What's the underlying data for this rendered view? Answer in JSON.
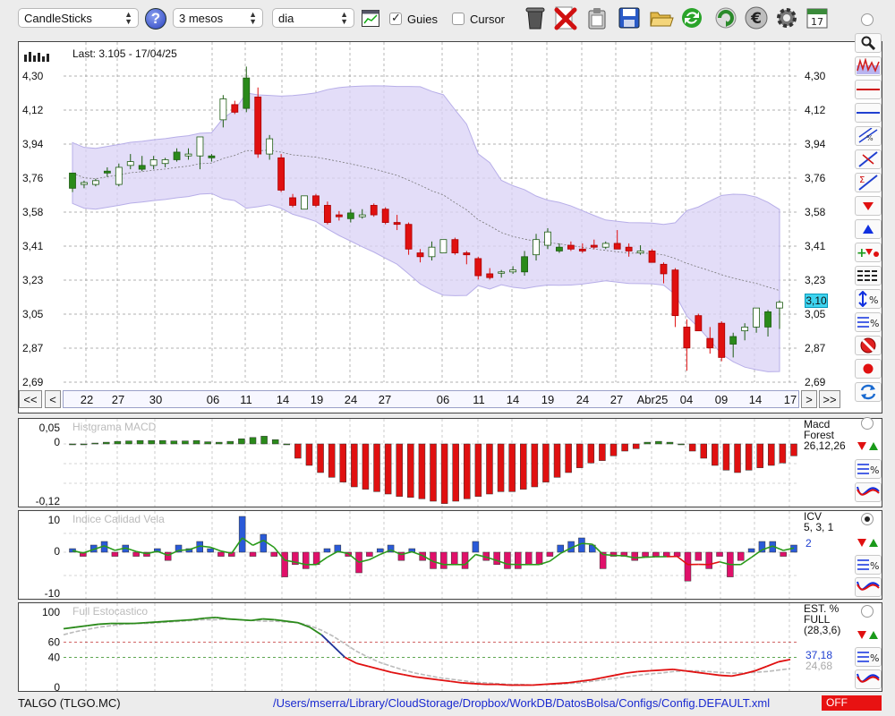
{
  "toolbar": {
    "chart_type": "CandleSticks",
    "period": "3 mesos",
    "interval": "dia",
    "guides_label": "Guies",
    "guides_checked": true,
    "cursor_label": "Cursor",
    "cursor_checked": false,
    "help": "?",
    "calendar_day": "17",
    "icons": [
      "trash-icon",
      "delete-icon",
      "paste-icon",
      "save-icon",
      "open-folder-icon",
      "refresh-icon",
      "reload-icon",
      "euro-icon",
      "settings-icon",
      "calendar-icon"
    ]
  },
  "main_chart": {
    "last_label": "Last: 3.105 - 17/04/25",
    "price_tag": "3,10",
    "y_ticks": [
      "4,30",
      "4,12",
      "3,94",
      "3,76",
      "3,58",
      "3,41",
      "3,23",
      "3,05",
      "2,87",
      "2,69"
    ],
    "x_ticks": [
      "22",
      "27",
      "30",
      "06",
      "11",
      "14",
      "19",
      "24",
      "27",
      "06",
      "11",
      "14",
      "19",
      "24",
      "27",
      "Abr25",
      "04",
      "09",
      "14",
      "17"
    ],
    "nav": {
      "first": "<<",
      "prev": "<",
      "next": ">",
      "last": ">>"
    }
  },
  "macd": {
    "title": "Histgrama MACD",
    "y_ticks": [
      "0,05",
      "0",
      "-0,12"
    ],
    "label": "Macd\nForest\n26,12,26"
  },
  "icv": {
    "title": "Indice Calidad Vela",
    "y_ticks": [
      "10",
      "0",
      "-10"
    ],
    "label": "ICV\n5, 3, 1",
    "value": "2"
  },
  "stoch": {
    "title": "Full Estocastico",
    "y_ticks": [
      "100",
      "60",
      "40",
      "0"
    ],
    "label": "EST. %\nFULL\n(28,3,6)",
    "value_k": "37,18",
    "value_d": "24,68"
  },
  "footer": {
    "ticker": "TALGO (TLGO.MC)",
    "path": "/Users/mserra/Library/CloudStorage/Dropbox/WorkDB/DatosBolsa/Configs/Config.DEFAULT.xml",
    "status": "OFF"
  },
  "colors": {
    "up": "#2a8a1a",
    "down": "#e01010",
    "band": "#d9d2f5",
    "accent": "#3c5ad8"
  },
  "chart_data": [
    {
      "type": "candlestick",
      "x": [
        "22",
        "27",
        "30",
        "06",
        "11",
        "14",
        "19",
        "24",
        "27",
        "06",
        "11",
        "14",
        "19",
        "24",
        "27",
        "Abr25",
        "04",
        "09",
        "14",
        "17"
      ],
      "candles": [
        [
          3.71,
          3.79,
          3.69,
          3.79
        ],
        [
          3.73,
          3.75,
          3.71,
          3.74
        ],
        [
          3.73,
          3.76,
          3.72,
          3.75
        ],
        [
          3.79,
          3.82,
          3.77,
          3.8
        ],
        [
          3.73,
          3.84,
          3.72,
          3.82
        ],
        [
          3.83,
          3.89,
          3.81,
          3.85
        ],
        [
          3.81,
          3.88,
          3.8,
          3.83
        ],
        [
          3.83,
          3.88,
          3.81,
          3.86
        ],
        [
          3.84,
          3.87,
          3.82,
          3.86
        ],
        [
          3.86,
          3.92,
          3.85,
          3.9
        ],
        [
          3.88,
          3.92,
          3.86,
          3.89
        ],
        [
          3.88,
          3.97,
          3.81,
          3.98
        ],
        [
          3.87,
          3.89,
          3.85,
          3.88
        ],
        [
          4.07,
          4.2,
          4.03,
          4.18
        ],
        [
          4.15,
          4.17,
          4.1,
          4.11
        ],
        [
          4.13,
          4.35,
          4.11,
          4.29
        ],
        [
          4.19,
          4.24,
          3.87,
          3.89
        ],
        [
          3.89,
          3.99,
          3.86,
          3.97
        ],
        [
          3.87,
          3.89,
          3.69,
          3.7
        ],
        [
          3.66,
          3.68,
          3.61,
          3.62
        ],
        [
          3.6,
          3.67,
          3.6,
          3.67
        ],
        [
          3.67,
          3.68,
          3.61,
          3.62
        ],
        [
          3.62,
          3.64,
          3.52,
          3.53
        ],
        [
          3.57,
          3.59,
          3.54,
          3.56
        ],
        [
          3.55,
          3.6,
          3.53,
          3.58
        ],
        [
          3.56,
          3.6,
          3.55,
          3.57
        ],
        [
          3.62,
          3.63,
          3.56,
          3.57
        ],
        [
          3.6,
          3.61,
          3.52,
          3.53
        ],
        [
          3.53,
          3.57,
          3.49,
          3.52
        ],
        [
          3.52,
          3.53,
          3.36,
          3.39
        ],
        [
          3.37,
          3.39,
          3.32,
          3.35
        ],
        [
          3.35,
          3.43,
          3.33,
          3.4
        ],
        [
          3.37,
          3.44,
          3.37,
          3.44
        ],
        [
          3.44,
          3.45,
          3.36,
          3.37
        ],
        [
          3.37,
          3.38,
          3.31,
          3.36
        ],
        [
          3.34,
          3.35,
          3.23,
          3.25
        ],
        [
          3.26,
          3.29,
          3.23,
          3.24
        ],
        [
          3.27,
          3.28,
          3.24,
          3.27
        ],
        [
          3.27,
          3.3,
          3.26,
          3.28
        ],
        [
          3.27,
          3.38,
          3.25,
          3.35
        ],
        [
          3.36,
          3.47,
          3.33,
          3.44
        ],
        [
          3.41,
          3.5,
          3.39,
          3.48
        ],
        [
          3.38,
          3.42,
          3.37,
          3.4
        ],
        [
          3.41,
          3.43,
          3.38,
          3.39
        ],
        [
          3.39,
          3.42,
          3.37,
          3.38
        ],
        [
          3.41,
          3.44,
          3.39,
          3.4
        ],
        [
          3.4,
          3.43,
          3.39,
          3.42
        ],
        [
          3.42,
          3.49,
          3.39,
          3.39
        ],
        [
          3.4,
          3.42,
          3.35,
          3.38
        ],
        [
          3.37,
          3.41,
          3.36,
          3.38
        ],
        [
          3.38,
          3.39,
          3.32,
          3.32
        ],
        [
          3.31,
          3.32,
          3.21,
          3.26
        ],
        [
          3.28,
          3.29,
          2.98,
          3.04
        ],
        [
          2.98,
          3.02,
          2.75,
          2.87
        ],
        [
          3.04,
          3.05,
          2.96,
          2.96
        ],
        [
          2.92,
          2.98,
          2.84,
          2.87
        ],
        [
          3.0,
          3.01,
          2.8,
          2.82
        ],
        [
          2.89,
          2.95,
          2.82,
          2.93
        ],
        [
          2.96,
          3.0,
          2.91,
          2.98
        ],
        [
          2.98,
          3.08,
          2.95,
          3.08
        ],
        [
          2.98,
          3.07,
          2.93,
          3.06
        ],
        [
          3.08,
          3.12,
          2.97,
          3.11
        ]
      ],
      "ylim": [
        2.69,
        4.3
      ]
    },
    {
      "type": "bar",
      "name": "Histgrama MACD",
      "values": [
        0,
        0,
        0.002,
        0.004,
        0.006,
        0.007,
        0.008,
        0.008,
        0.008,
        0.007,
        0.007,
        0.008,
        0.005,
        0.004,
        0.006,
        0.012,
        0.015,
        0.018,
        0.01,
        0,
        -0.03,
        -0.045,
        -0.06,
        -0.07,
        -0.08,
        -0.09,
        -0.095,
        -0.1,
        -0.105,
        -0.11,
        -0.112,
        -0.115,
        -0.12,
        -0.125,
        -0.12,
        -0.115,
        -0.11,
        -0.105,
        -0.1,
        -0.1,
        -0.095,
        -0.09,
        -0.08,
        -0.07,
        -0.06,
        -0.05,
        -0.04,
        -0.035,
        -0.025,
        -0.015,
        -0.01,
        0.004,
        0.006,
        0.004,
        0,
        -0.015,
        -0.03,
        -0.045,
        -0.055,
        -0.06,
        -0.055,
        -0.05,
        -0.045,
        -0.04,
        -0.025
      ],
      "ylim": [
        -0.12,
        0.05
      ]
    },
    {
      "type": "bar",
      "name": "Indice Calidad Vela",
      "values": [
        1,
        -1,
        2,
        3,
        -1,
        2,
        -1,
        -1,
        1,
        -2,
        2,
        1,
        3,
        1,
        -1,
        -1,
        10,
        -1,
        5,
        -1,
        -6,
        -3,
        -4,
        -3,
        1,
        2,
        -1,
        -5,
        -1,
        1,
        2,
        -2,
        1,
        -2,
        -4,
        -4,
        -3,
        -4,
        3,
        -2,
        -3,
        -4,
        -4,
        -3,
        -3,
        -1,
        2,
        3,
        4,
        2,
        -4,
        -1,
        -1,
        -2,
        -1,
        -1,
        -1,
        -1,
        -7,
        -2,
        -4,
        -1,
        -6,
        -2,
        1,
        3,
        3,
        -1,
        2
      ],
      "ylim": [
        -10,
        10
      ]
    },
    {
      "type": "line",
      "name": "Full Estocastico",
      "ylim": [
        0,
        100
      ],
      "series": [
        {
          "values": [
            78,
            80,
            82,
            84,
            85,
            85,
            85,
            86,
            87,
            88,
            89,
            90,
            92,
            93,
            91,
            90,
            89,
            91,
            90,
            88,
            86,
            80,
            70,
            55,
            40,
            32,
            28,
            24,
            20,
            17,
            14,
            12,
            10,
            8,
            6,
            5,
            4,
            4,
            3,
            3,
            3,
            4,
            5,
            6,
            8,
            10,
            13,
            16,
            19,
            21,
            22,
            23,
            24,
            22,
            20,
            18,
            16,
            15,
            18,
            22,
            28,
            34,
            37
          ]
        },
        {
          "values": [
            70,
            74,
            77,
            80,
            82,
            84,
            85,
            85,
            86,
            87,
            88,
            89,
            90,
            90,
            91,
            90,
            89,
            88,
            88,
            87,
            86,
            82,
            76,
            68,
            58,
            48,
            40,
            33,
            28,
            23,
            19,
            16,
            13,
            11,
            9,
            7,
            6,
            5,
            4,
            4,
            3,
            4,
            4,
            5,
            6,
            8,
            10,
            12,
            14,
            16,
            18,
            19,
            21,
            22,
            22,
            21,
            20,
            19,
            19,
            20,
            21,
            23,
            25
          ]
        }
      ]
    }
  ]
}
